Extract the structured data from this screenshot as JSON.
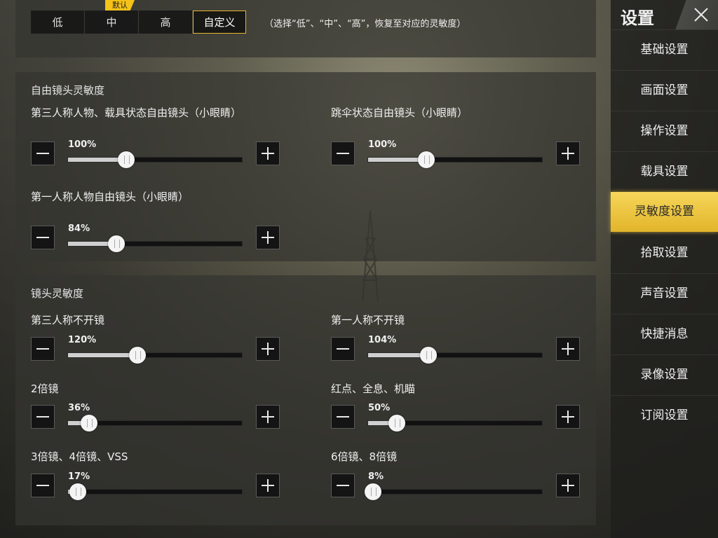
{
  "presets": {
    "default_badge": "默认",
    "buttons": [
      "低",
      "中",
      "高",
      "自定义"
    ],
    "active": "自定义",
    "hint": "（选择“低”、“中”、“高”，恢复至对应的灵敏度）"
  },
  "free_camera": {
    "title": "自由镜头灵敏度",
    "items": [
      {
        "label": "第三人称人物、载具状态自由镜头（小眼睛）",
        "value": 100,
        "text": "100%"
      },
      {
        "label": "跳伞状态自由镜头（小眼睛）",
        "value": 100,
        "text": "100%"
      },
      {
        "label": "第一人称人物自由镜头（小眼睛）",
        "value": 84,
        "text": "84%"
      }
    ]
  },
  "lens": {
    "title": "镜头灵敏度",
    "items": [
      {
        "label": "第三人称不开镜",
        "value": 120,
        "text": "120%"
      },
      {
        "label": "第一人称不开镜",
        "value": 104,
        "text": "104%"
      },
      {
        "label": "2倍镜",
        "value": 36,
        "text": "36%"
      },
      {
        "label": "红点、全息、机瞄",
        "value": 50,
        "text": "50%"
      },
      {
        "label": "3倍镜、4倍镜、VSS",
        "value": 17,
        "text": "17%"
      },
      {
        "label": "6倍镜、8倍镜",
        "value": 8,
        "text": "8%"
      }
    ]
  },
  "sidebar": {
    "title": "设置",
    "items": [
      "基础设置",
      "画面设置",
      "操作设置",
      "载具设置",
      "灵敏度设置",
      "拾取设置",
      "声音设置",
      "快捷消息",
      "录像设置",
      "订阅设置"
    ],
    "active": "灵敏度设置"
  },
  "colors": {
    "accent": "#f4c218",
    "active_border": "#e6b631"
  },
  "icons": {
    "close": "close-icon",
    "minus": "minus-icon",
    "plus": "plus-icon"
  }
}
